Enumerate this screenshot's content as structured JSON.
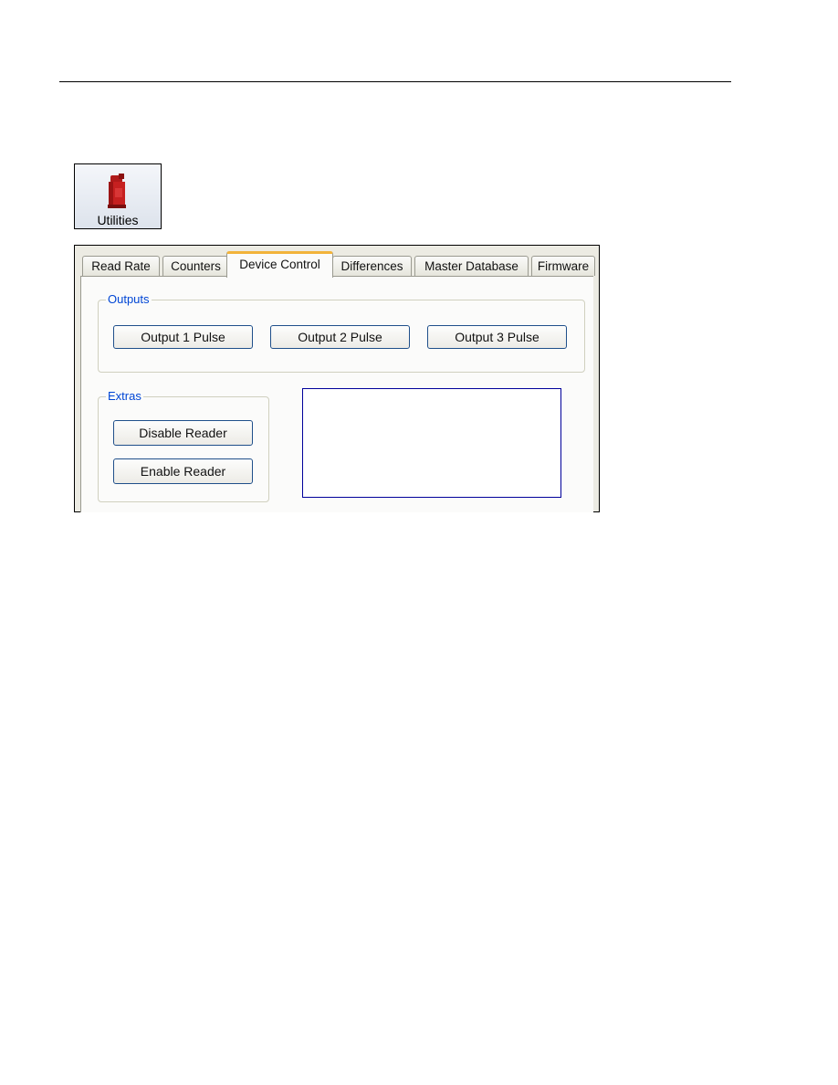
{
  "toolbar": {
    "utilities": {
      "label": "Utilities",
      "icon": "reader-device-icon"
    }
  },
  "dialog": {
    "tabs": [
      {
        "label": "Read Rate",
        "active": false
      },
      {
        "label": "Counters",
        "active": false
      },
      {
        "label": "Device Control",
        "active": true
      },
      {
        "label": "Differences",
        "active": false
      },
      {
        "label": "Master Database",
        "active": false
      },
      {
        "label": "Firmware",
        "active": false
      }
    ],
    "outputs": {
      "title": "Outputs",
      "buttons": [
        "Output 1 Pulse",
        "Output 2 Pulse",
        "Output 3 Pulse"
      ]
    },
    "extras": {
      "title": "Extras",
      "buttons": [
        "Disable Reader",
        "Enable Reader"
      ]
    },
    "log_box": {
      "content": ""
    }
  },
  "colors": {
    "group_label": "#0046d5",
    "active_tab_accent": "#f2b33a",
    "button_border": "#1f4f8a",
    "listbox_border": "#00009a"
  }
}
